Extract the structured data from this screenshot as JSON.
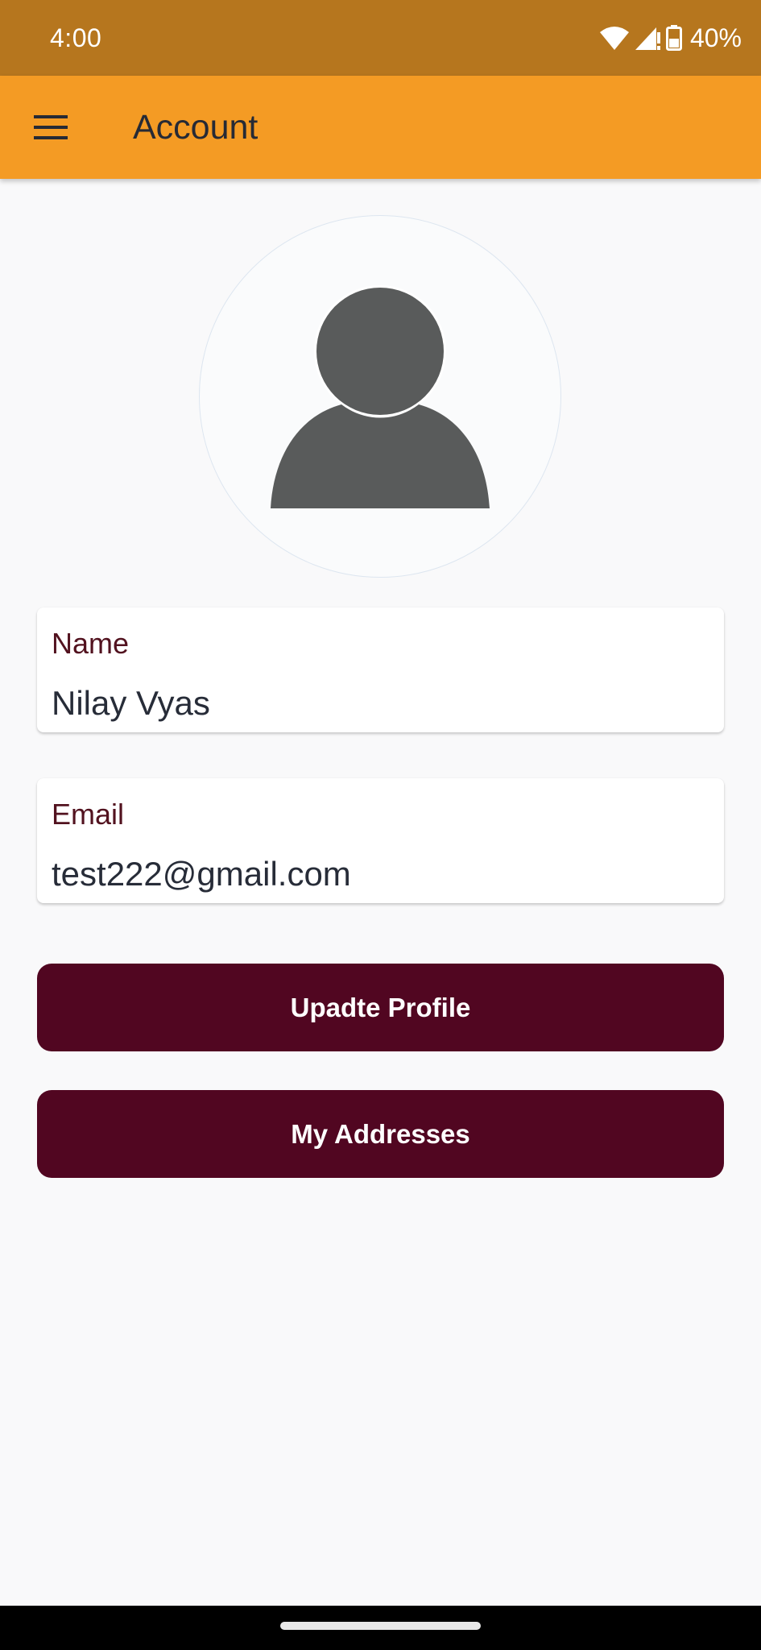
{
  "status_bar": {
    "time": "4:00",
    "battery_percent": "40%",
    "icons": [
      "wifi-icon",
      "cell-signal-icon",
      "battery-icon"
    ]
  },
  "app_bar": {
    "title": "Account",
    "menu_icon": "hamburger-menu-icon"
  },
  "profile": {
    "avatar_icon": "person-silhouette-icon",
    "name_label": "Name",
    "name_value": "Nilay Vyas",
    "email_label": "Email",
    "email_value": "test222@gmail.com"
  },
  "actions": {
    "update_profile_label": "Upadte Profile",
    "my_addresses_label": "My Addresses"
  },
  "colors": {
    "status_bar": "#b6761e",
    "app_bar": "#f49b24",
    "button": "#510621",
    "label": "#52121f",
    "background": "#f9f9fa"
  }
}
